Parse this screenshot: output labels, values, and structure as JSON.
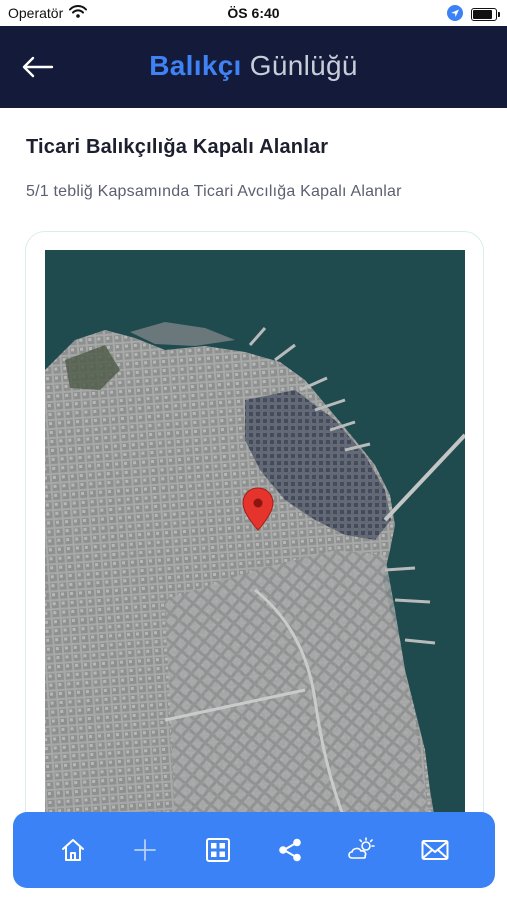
{
  "status_bar": {
    "carrier": "Operatör",
    "time": "ÖS 6:40"
  },
  "header": {
    "title_accent": "Balıkçı",
    "title_rest": "Günlüğü",
    "back_icon": "arrow-left-icon"
  },
  "content": {
    "heading": "Ticari Balıkçılığa Kapalı Alanlar",
    "subheading": "5/1 tebliğ Kapsamında Ticari Avcılığa Kapalı Alanlar"
  },
  "map": {
    "view": "satellite",
    "marker_icon": "map-pin-icon",
    "marker_color": "#e5342c"
  },
  "tab_bar": {
    "background": "#3b82f6",
    "items": [
      {
        "icon": "home-icon"
      },
      {
        "icon": "plus-icon"
      },
      {
        "icon": "grid-icon"
      },
      {
        "icon": "share-icon"
      },
      {
        "icon": "weather-icon"
      },
      {
        "icon": "mail-icon"
      }
    ]
  }
}
